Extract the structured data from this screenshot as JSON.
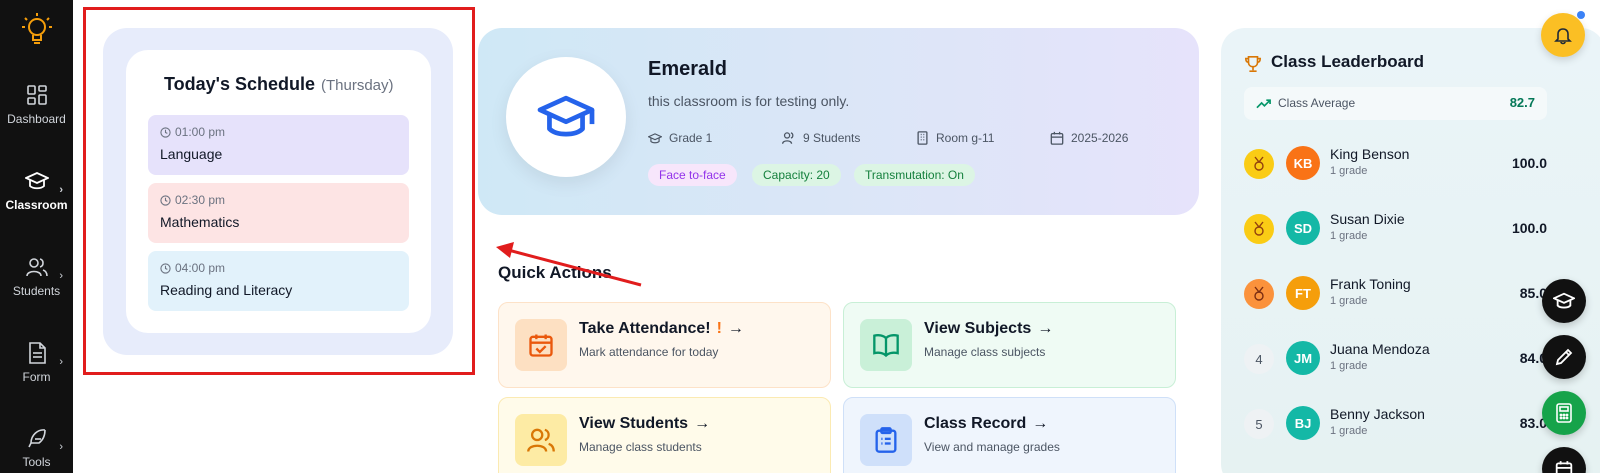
{
  "sidebar": {
    "items": [
      {
        "label": "Dashboard",
        "icon": "grid-icon"
      },
      {
        "label": "Classroom",
        "icon": "graduation-cap-icon"
      },
      {
        "label": "Students",
        "icon": "users-icon"
      },
      {
        "label": "Form",
        "icon": "document-icon"
      },
      {
        "label": "Tools",
        "icon": "feather-icon"
      }
    ]
  },
  "schedule": {
    "title": "Today's Schedule",
    "day": "(Thursday)",
    "items": [
      {
        "time": "01:00 pm",
        "subject": "Language",
        "color": "#e6e2fb"
      },
      {
        "time": "02:30 pm",
        "subject": "Mathematics",
        "color": "#fde4e4"
      },
      {
        "time": "04:00 pm",
        "subject": "Reading and Literacy",
        "color": "#e2f2fb"
      }
    ]
  },
  "classroom": {
    "name": "Emerald",
    "description": "this classroom is for testing only.",
    "grade": "Grade 1",
    "students": "9 Students",
    "room": "Room g-11",
    "year": "2025-2026",
    "tags": [
      {
        "label": "Face to-face",
        "bg": "#f7e6fb",
        "color": "#9333ea"
      },
      {
        "label": "Capacity: 20",
        "bg": "#dcf5e4",
        "color": "#15803d"
      },
      {
        "label": "Transmutation: On",
        "bg": "#dcf5e4",
        "color": "#15803d"
      }
    ]
  },
  "quick_actions": {
    "title": "Quick Actions",
    "items": [
      {
        "title": "Take Attendance!",
        "exclaim": "!",
        "subtitle": "Mark attendance for today",
        "icon": "calendar-check-icon"
      },
      {
        "title": "View Subjects",
        "subtitle": "Manage class subjects",
        "icon": "book-icon"
      },
      {
        "title": "View Students",
        "subtitle": "Manage class students",
        "icon": "users-icon"
      },
      {
        "title": "Class Record",
        "subtitle": "View and manage grades",
        "icon": "clipboard-icon"
      }
    ]
  },
  "leaderboard": {
    "title": "Class Leaderboard",
    "average_label": "Class Average",
    "average_value": "82.7",
    "entries": [
      {
        "rank": "",
        "initials": "KB",
        "name": "King Benson",
        "grade": "1 grade",
        "score": "100.0",
        "avatar_color": "#f97316",
        "medal": "gold"
      },
      {
        "rank": "",
        "initials": "SD",
        "name": "Susan Dixie",
        "grade": "1 grade",
        "score": "100.0",
        "avatar_color": "#14b8a6",
        "medal": "gold"
      },
      {
        "rank": "",
        "initials": "FT",
        "name": "Frank Toning",
        "grade": "1 grade",
        "score": "85.0",
        "avatar_color": "#f59e0b",
        "medal": "bronze"
      },
      {
        "rank": "4",
        "initials": "JM",
        "name": "Juana Mendoza",
        "grade": "1 grade",
        "score": "84.0",
        "avatar_color": "#14b8a6",
        "medal": ""
      },
      {
        "rank": "5",
        "initials": "BJ",
        "name": "Benny Jackson",
        "grade": "1 grade",
        "score": "83.0",
        "avatar_color": "#14b8a6",
        "medal": ""
      }
    ]
  }
}
